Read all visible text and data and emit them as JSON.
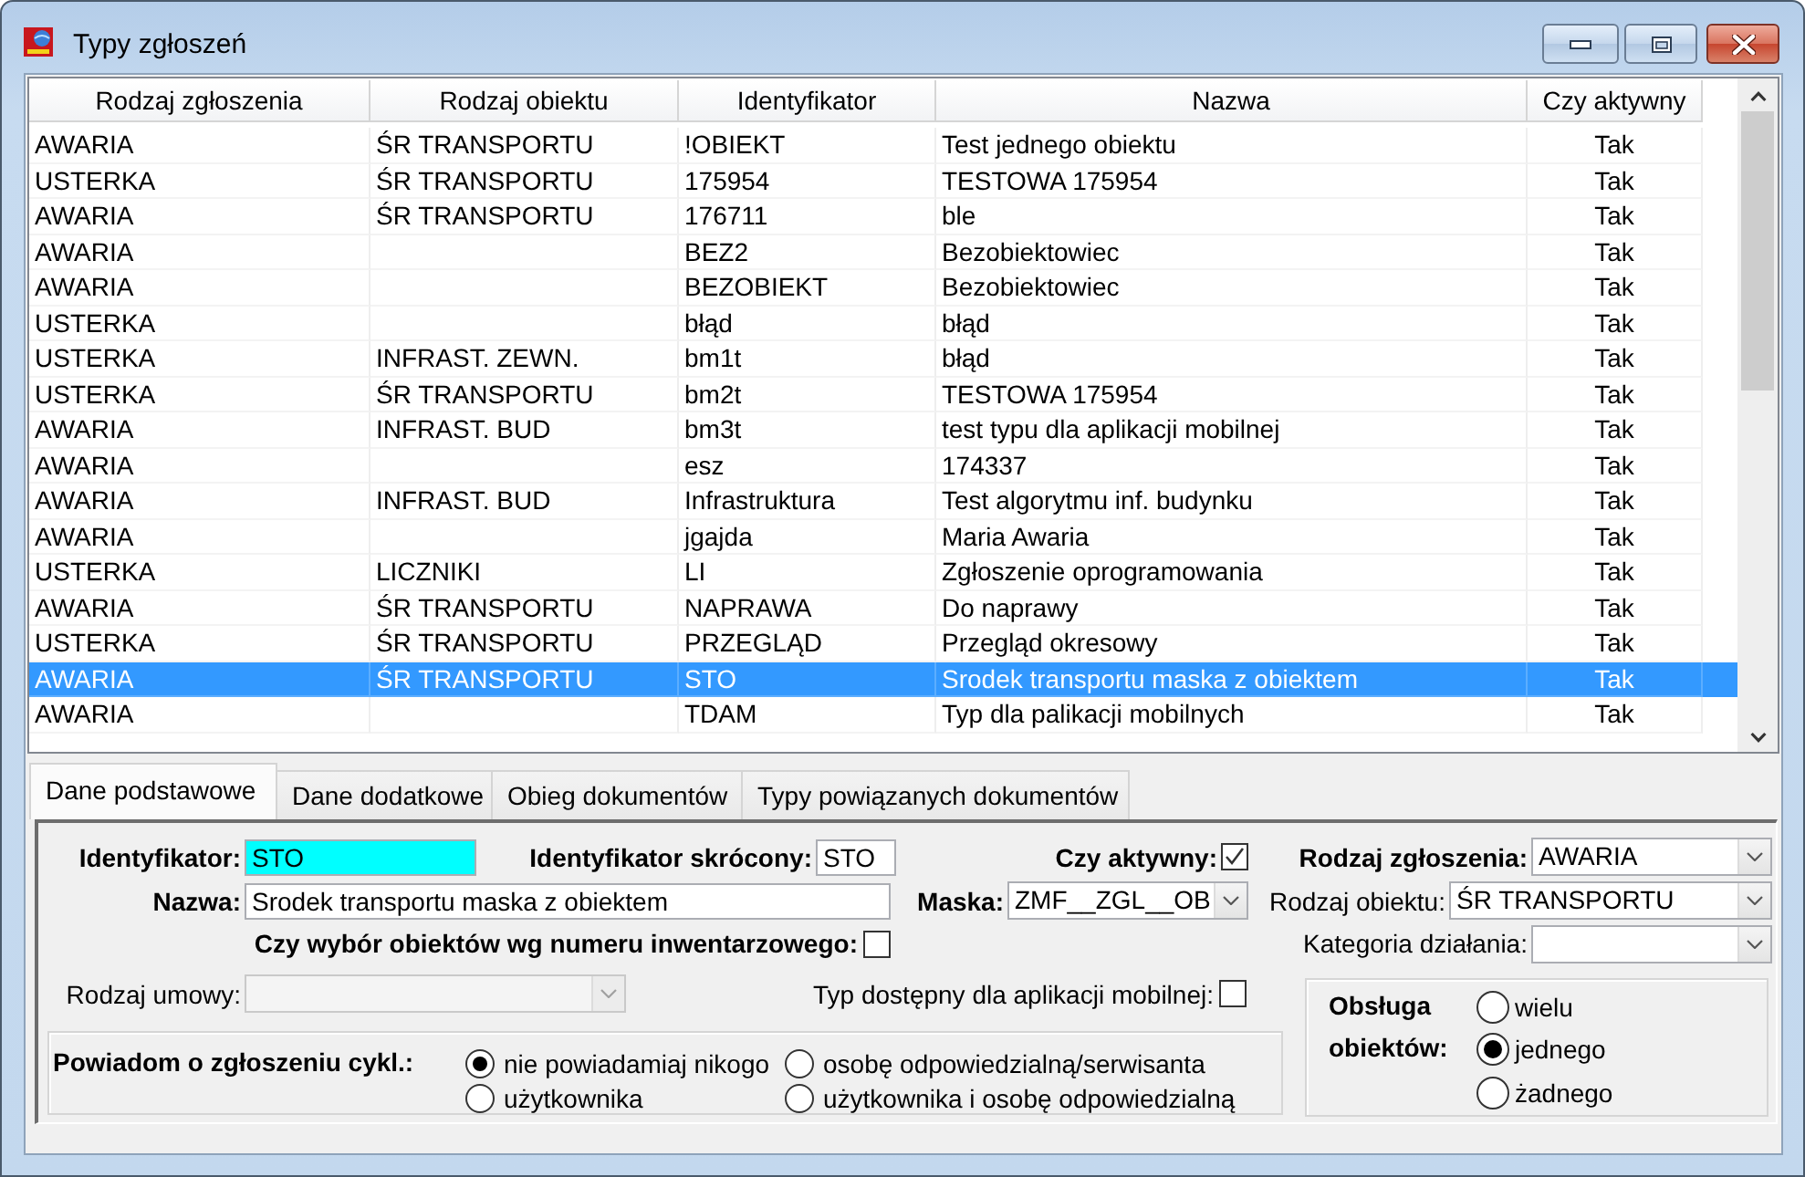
{
  "window": {
    "title": "Typy zgłoszeń"
  },
  "table": {
    "columns": [
      "Rodzaj zgłoszenia",
      "Rodzaj obiektu",
      "Identyfikator",
      "Nazwa",
      "Czy aktywny"
    ],
    "rows": [
      {
        "cells": [
          "AWARIA",
          "ŚR TRANSPORTU",
          "!OBIEKT",
          "Test jednego obiektu",
          "Tak"
        ],
        "selected": false
      },
      {
        "cells": [
          "USTERKA",
          "ŚR TRANSPORTU",
          "175954",
          "TESTOWA 175954",
          "Tak"
        ],
        "selected": false
      },
      {
        "cells": [
          "AWARIA",
          "ŚR TRANSPORTU",
          "176711",
          "ble",
          "Tak"
        ],
        "selected": false
      },
      {
        "cells": [
          "AWARIA",
          null,
          "BEZ2",
          "Bezobiektowiec",
          "Tak"
        ],
        "selected": false
      },
      {
        "cells": [
          "AWARIA",
          null,
          "BEZOBIEKT",
          "Bezobiektowiec",
          "Tak"
        ],
        "selected": false
      },
      {
        "cells": [
          "USTERKA",
          null,
          "błąd",
          "błąd",
          "Tak"
        ],
        "selected": false
      },
      {
        "cells": [
          "USTERKA",
          "INFRAST. ZEWN.",
          "bm1t",
          "błąd",
          "Tak"
        ],
        "selected": false
      },
      {
        "cells": [
          "USTERKA",
          "ŚR TRANSPORTU",
          "bm2t",
          "TESTOWA 175954",
          "Tak"
        ],
        "selected": false
      },
      {
        "cells": [
          "AWARIA",
          "INFRAST. BUD",
          "bm3t",
          "test typu dla aplikacji mobilnej",
          "Tak"
        ],
        "selected": false
      },
      {
        "cells": [
          "AWARIA",
          null,
          "esz",
          "174337",
          "Tak"
        ],
        "selected": false
      },
      {
        "cells": [
          "AWARIA",
          "INFRAST. BUD",
          "Infrastruktura",
          "Test algorytmu inf. budynku",
          "Tak"
        ],
        "selected": false
      },
      {
        "cells": [
          "AWARIA",
          null,
          "jgajda",
          "Maria Awaria",
          "Tak"
        ],
        "selected": false
      },
      {
        "cells": [
          "USTERKA",
          "LICZNIKI",
          "LI",
          "Zgłoszenie oprogramowania",
          "Tak"
        ],
        "selected": false
      },
      {
        "cells": [
          "AWARIA",
          "ŚR TRANSPORTU",
          "NAPRAWA",
          "Do naprawy",
          "Tak"
        ],
        "selected": false
      },
      {
        "cells": [
          "USTERKA",
          "ŚR TRANSPORTU",
          "PRZEGLĄD",
          "Przegląd okresowy",
          "Tak"
        ],
        "selected": false
      },
      {
        "cells": [
          "AWARIA",
          "ŚR TRANSPORTU",
          "STO",
          "Srodek transportu maska z obiektem",
          "Tak"
        ],
        "selected": true
      },
      {
        "cells": [
          "AWARIA",
          null,
          "TDAM",
          "Typ dla palikacji mobilnych",
          "Tak"
        ],
        "selected": false
      }
    ]
  },
  "tabs": [
    {
      "label": "Dane podstawowe",
      "selected": true
    },
    {
      "label": "Dane dodatkowe",
      "selected": false
    },
    {
      "label": "Obieg dokumentów",
      "selected": false
    },
    {
      "label": "Typy powiązanych dokumentów",
      "selected": false
    }
  ],
  "form": {
    "identyfikator": {
      "label": "Identyfikator:",
      "required": true,
      "value": "STO",
      "highlighted": true
    },
    "identyfikator_skrocony": {
      "label": "Identyfikator skrócony:",
      "required": true,
      "value": "STO",
      "highlighted": false
    },
    "czy_aktywny": {
      "label": "Czy aktywny:",
      "required": true,
      "checked": true
    },
    "rodzaj_zgloszenia": {
      "label": "Rodzaj zgłoszenia:",
      "required": true,
      "value": "AWARIA",
      "disabled": false
    },
    "nazwa": {
      "label": "Nazwa:",
      "required": true,
      "value": "Srodek transportu maska z obiektem",
      "highlighted": false
    },
    "maska": {
      "label": "Maska:",
      "required": true,
      "value": "ZMF__ZGL__OB",
      "disabled": false
    },
    "rodzaj_obiektu": {
      "label": "Rodzaj obiektu:",
      "required": false,
      "value": "ŚR TRANSPORTU",
      "disabled": false
    },
    "wybor_wg_numeru": {
      "label": "Czy wybór obiektów wg numeru inwentarzowego:",
      "required": true,
      "checked": false
    },
    "kategoria_dzialania": {
      "label": "Kategoria działania:",
      "required": false,
      "disabled": false
    },
    "rodzaj_umowy": {
      "label": "Rodzaj umowy:",
      "required": false,
      "disabled": true
    },
    "typ_mobilny": {
      "label": "Typ dostępny dla aplikacji mobilnej:",
      "required": false,
      "checked": false
    },
    "powiadom": {
      "label": "Powiadom o zgłoszeniu cykl.:",
      "options": [
        {
          "label": "nie powiadamiaj nikogo",
          "selected": true
        },
        {
          "label": "użytkownika",
          "selected": false
        },
        {
          "label": "osobę odpowiedzialną/serwisanta",
          "selected": false
        },
        {
          "label": "użytkownika i osobę odpowiedzialną",
          "selected": false
        }
      ]
    },
    "obsluga": {
      "label": "Obsługa obiektów:",
      "options": [
        {
          "label": "wielu",
          "selected": false
        },
        {
          "label": "jednego",
          "selected": true
        },
        {
          "label": "żadnego",
          "selected": false
        }
      ]
    }
  }
}
